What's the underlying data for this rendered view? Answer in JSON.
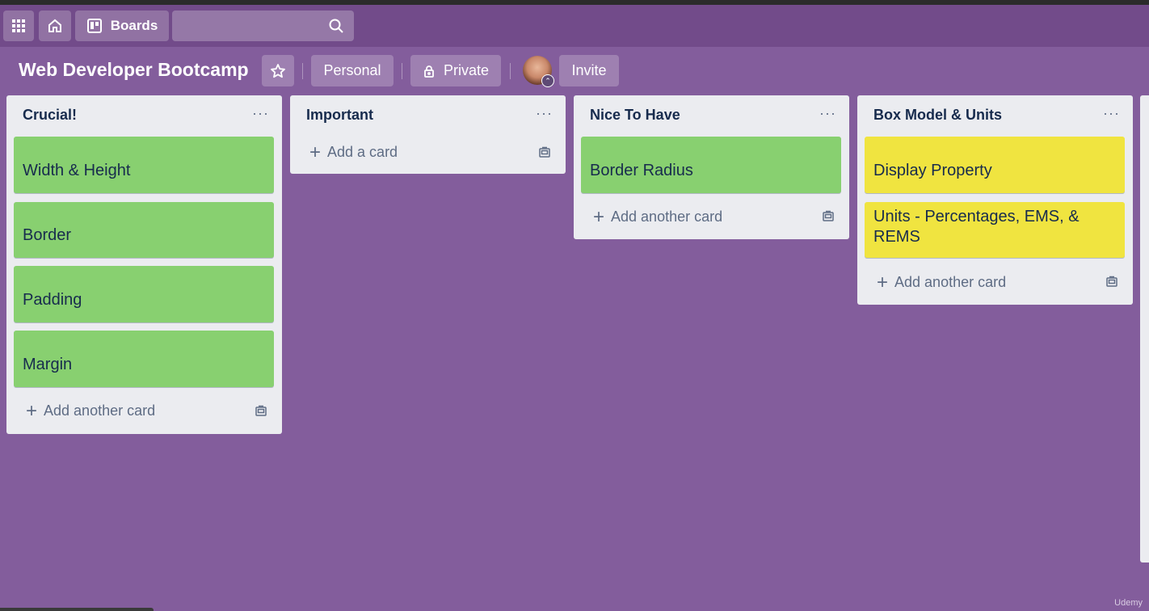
{
  "topbar": {
    "boards_label": "Boards",
    "search_placeholder": ""
  },
  "board": {
    "title": "Web Developer Bootcamp",
    "visibility_team": "Personal",
    "visibility": "Private",
    "invite_label": "Invite"
  },
  "lists": [
    {
      "title": "Crucial!",
      "cards": [
        "Width & Height",
        "Border",
        "Padding",
        "Margin"
      ],
      "add_label": "Add another card"
    },
    {
      "title": "Important",
      "cards": [],
      "add_label": "Add a card"
    },
    {
      "title": "Nice To Have",
      "cards": [
        "Border Radius"
      ],
      "add_label": "Add another card"
    },
    {
      "title": "Box Model & Units",
      "cards": [
        "Display Property",
        "Units - Percentages, EMS, & REMS"
      ],
      "add_label": "Add another card"
    }
  ],
  "list_menu_glyph": "···",
  "watermark": "Udemy",
  "colors": {
    "board_bg": "#835d9c",
    "topbar_bg": "#724b8a",
    "list_bg": "#ebecf0",
    "label_green": "#88d070",
    "label_yellow": "#f0e440",
    "text_dark": "#172b4d"
  },
  "icons": [
    "apps-grid-icon",
    "home-icon",
    "boards-icon",
    "search-icon",
    "star-icon",
    "lock-icon",
    "card-template-icon"
  ]
}
